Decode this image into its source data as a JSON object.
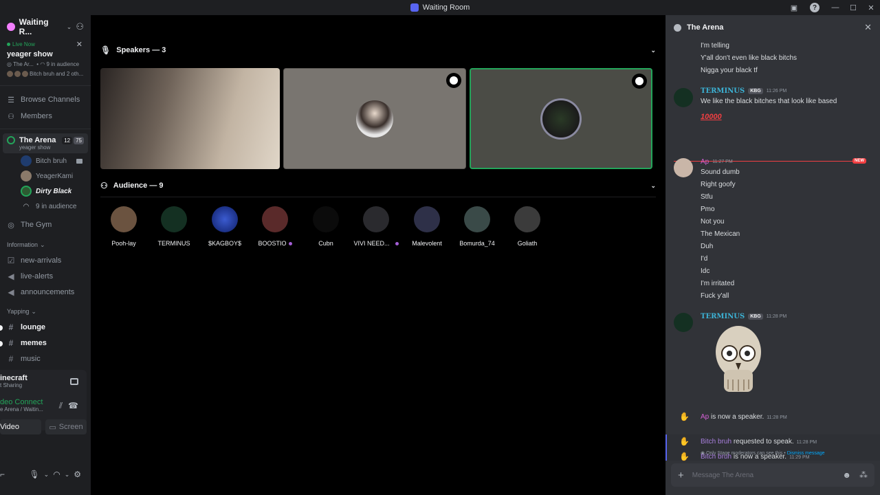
{
  "window": {
    "title": "Waiting Room"
  },
  "server": {
    "name": "Waiting R..."
  },
  "live": {
    "badge": "Live Now",
    "show": "yeager show",
    "meta_stage": "The Ar...",
    "meta_audience": "9 in audience",
    "meta_speakers": "Bitch bruh and 2 oth..."
  },
  "nav": {
    "browse": "Browse Channels",
    "members": "Members"
  },
  "stage_channel": {
    "name": "The Arena",
    "count_a": "12",
    "count_b": "75",
    "topic": "yeager show",
    "users": [
      "Bitch bruh",
      "YeagerKami",
      "Dirty Black"
    ],
    "audience": "9 in audience"
  },
  "gym": "The Gym",
  "categories": {
    "information": "Information",
    "yapping": "Yapping"
  },
  "info_channels": [
    "new-arrivals",
    "live-alerts",
    "announcements"
  ],
  "yap_channels": [
    "lounge",
    "memes",
    "music"
  ],
  "activity": {
    "game": "inecraft",
    "game_sub": "t Sharing",
    "voice": "deo Connect",
    "voice_sub": "e Arena / Waitin...",
    "video_btn": "Video",
    "screen_btn": "Screen"
  },
  "stage": {
    "speakers_header": "Speakers — 3",
    "audience_header": "Audience — 9",
    "audience": [
      {
        "name": "Pooh-lay",
        "color": "#6b5340"
      },
      {
        "name": "TERMINUS",
        "color": "#143022"
      },
      {
        "name": "$KAGBOY$",
        "color": "#1c3a9a"
      },
      {
        "name": "BOOSTIO",
        "color": "#5a2a2a"
      },
      {
        "name": "Cubn",
        "color": "#0b0b0b"
      },
      {
        "name": "VIVI NEED...",
        "color": "#2a2a2e"
      },
      {
        "name": "Malevolent",
        "color": "#2e3048"
      },
      {
        "name": "Bomurda_74",
        "color": "#3a4a48"
      },
      {
        "name": "Goliath",
        "color": "#3b3b3b"
      }
    ]
  },
  "chat": {
    "title": "The Arena",
    "top_lines": [
      "I'm telling",
      "Y'all don't even like black bitchs",
      "Nigga your black tf"
    ],
    "msg1": {
      "user": "TERMINUS",
      "tag": "KBG",
      "time": "11:26 PM",
      "text": "We like the black bitches that look like based",
      "emoji": "10000"
    },
    "new_label": "NEW",
    "msg2": {
      "user": "Ap",
      "time": "11:27 PM",
      "lines": [
        "Sound dumb",
        "Right goofy",
        "Stfu",
        "Pmo",
        "Not you",
        "The Mexican",
        "Duh",
        "I'd",
        "Idc",
        "I'm irritated",
        "Fuck y'all"
      ]
    },
    "msg3": {
      "user": "TERMINUS",
      "tag": "KBG",
      "time": "11:28 PM"
    },
    "sys1": {
      "user": "Ap",
      "text": "is now a speaker.",
      "time": "11:28 PM"
    },
    "sys2": {
      "user": "Bitch bruh",
      "text": "requested to speak.",
      "time": "11:28 PM",
      "note": "Only Stage moderators can see this •",
      "dismiss": "Dismiss message"
    },
    "sys3": {
      "user": "Bitch bruh",
      "text": "is now a speaker.",
      "time": "11:29 PM"
    },
    "placeholder": "Message The Arena"
  },
  "colors": {
    "accent": "#5865f2",
    "live_green": "#23a55a",
    "terminus": "#3cb3d6",
    "ap": "#d45fd4",
    "bitch_bruh": "#a87fdc",
    "new_red": "#f23f42"
  }
}
